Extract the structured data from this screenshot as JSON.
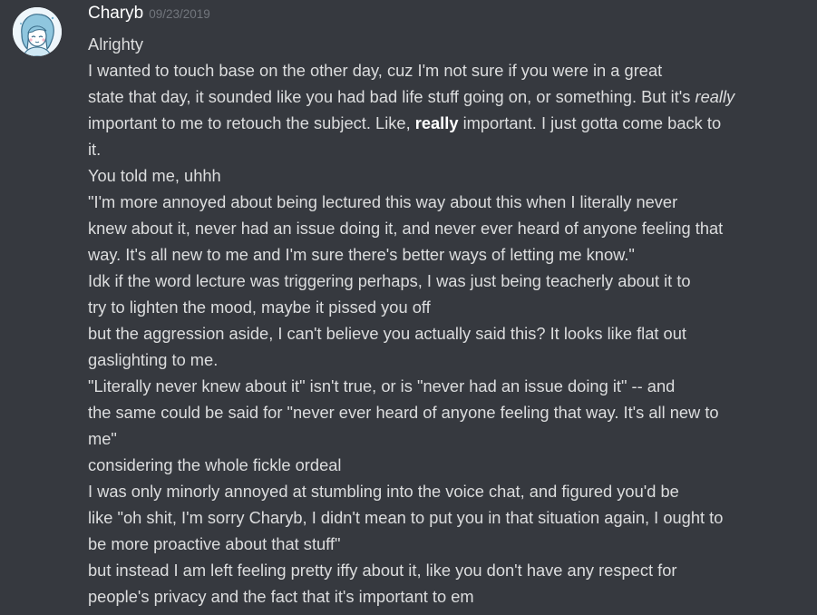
{
  "message": {
    "author": "Charyb",
    "timestamp": "09/23/2019",
    "lines": [
      [
        {
          "text": "Alrighty"
        }
      ],
      [
        {
          "text": "I wanted to touch base on the other day, cuz I'm not sure if you were in a great"
        }
      ],
      [
        {
          "text": "state that day, it sounded like you had bad life stuff going on, or something. But it's "
        },
        {
          "text": "really",
          "style": "em"
        }
      ],
      [
        {
          "text": "important to me to retouch the subject. Like, "
        },
        {
          "text": "really",
          "style": "strong"
        },
        {
          "text": " important. I just gotta come back to"
        }
      ],
      [
        {
          "text": "it."
        }
      ],
      [
        {
          "text": "You told me, uhhh"
        }
      ],
      [
        {
          "text": "\"I'm more annoyed about being lectured this way about this when I literally never"
        }
      ],
      [
        {
          "text": "knew about it, never had an issue doing it, and never ever heard of anyone feeling that"
        }
      ],
      [
        {
          "text": "way. It's all new to me and I'm sure there's better ways of letting me know.\""
        }
      ],
      [
        {
          "text": "Idk if the word lecture was triggering perhaps, I was just being teacherly about it to"
        }
      ],
      [
        {
          "text": "try to lighten the mood, maybe it pissed you off"
        }
      ],
      [
        {
          "text": "but the aggression aside, I can't believe you actually said this? It looks like flat out"
        }
      ],
      [
        {
          "text": "gaslighting to me."
        }
      ],
      [
        {
          "text": "\"Literally never knew about it\" isn't true, or is \"never had an issue doing it\" -- and"
        }
      ],
      [
        {
          "text": "the same could be said for \"never ever heard of anyone feeling that way. It's all new to"
        }
      ],
      [
        {
          "text": "me\""
        }
      ],
      [
        {
          "text": "considering the whole fickle ordeal"
        }
      ],
      [
        {
          "text": "I was only minorly annoyed at stumbling into the voice chat, and figured you'd be"
        }
      ],
      [
        {
          "text": "like \"oh shit, I'm sorry Charyb, I didn't mean to put you in that situation again, I ought to"
        }
      ],
      [
        {
          "text": "be more proactive about that stuff\""
        }
      ],
      [
        {
          "text": "but instead I am left feeling pretty iffy about it, like you don't have any respect for"
        }
      ],
      [
        {
          "text": "people's privacy and the fact that it's important to em"
        }
      ]
    ]
  },
  "colors": {
    "background": "#36393f",
    "message_text": "#dcddde",
    "username": "#ffffff",
    "timestamp": "#72767d"
  },
  "icons": {
    "avatar": "avatar-illustration-icon"
  }
}
